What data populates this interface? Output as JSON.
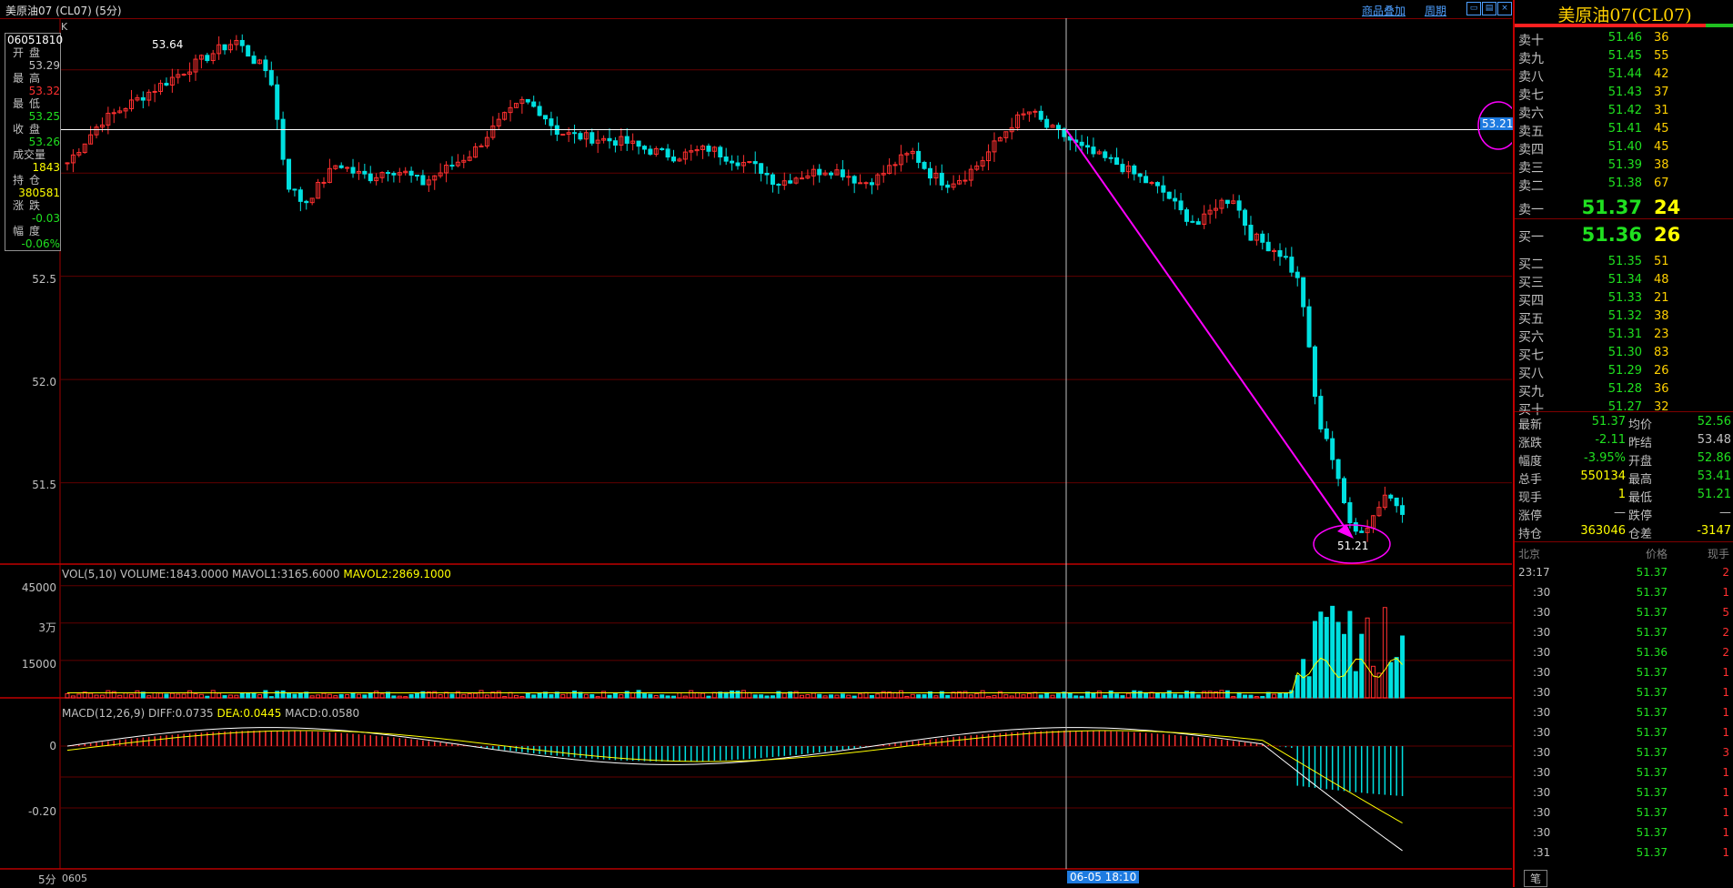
{
  "window": {
    "title": "美原油07 (CL07) (5分)",
    "links": [
      "商品叠加",
      "周期"
    ]
  },
  "ohlc_box": {
    "date": "06051810",
    "rows": [
      {
        "label": "开盘",
        "value": "53.29",
        "color": "#c0c0c0"
      },
      {
        "label": "最高",
        "value": "53.32",
        "color": "#ff3030"
      },
      {
        "label": "最低",
        "value": "53.25",
        "color": "#20e020"
      },
      {
        "label": "收盘",
        "value": "53.26",
        "color": "#20e020"
      },
      {
        "label": "成交量",
        "value": "1843",
        "color": "#ffff00"
      },
      {
        "label": "持仓",
        "value": "380581",
        "color": "#ffff00"
      },
      {
        "label": "涨跌",
        "value": "-0.03",
        "color": "#20e020"
      },
      {
        "label": "幅度",
        "value": "-0.06%",
        "color": "#20e020"
      }
    ]
  },
  "main_chart": {
    "k_label": "K",
    "y_ticks": [
      "52.5",
      "52.0",
      "51.5"
    ],
    "high_annotation": "53.64",
    "low_annotation": "51.21",
    "crosshair_price": "53.21",
    "crosshair_time": "06-05 18:10"
  },
  "volume_panel": {
    "title_parts": [
      "VOL(5,10) VOLUME:1843.0000",
      "MAVOL1:3165.6000",
      "MAVOL2:2869.1000"
    ],
    "colors": [
      "#ffffff",
      "#ffffff",
      "#ffff00"
    ],
    "y_ticks": [
      "45000",
      "3万",
      "15000"
    ]
  },
  "macd_panel": {
    "title_parts": [
      "MACD(12,26,9)",
      "DIFF:0.0735",
      "DEA:0.0445",
      "MACD:0.0580"
    ],
    "colors": [
      "#ffffff",
      "#ffffff",
      "#ffff00",
      "#ffffff"
    ],
    "y_ticks": [
      "0",
      "-0.20"
    ]
  },
  "bottom_bar": {
    "period": "5分",
    "date_start": "0605"
  },
  "chart_data": {
    "type": "candlestick",
    "title": "美原油07 (CL07) (5分)",
    "ylim": [
      51.15,
      53.75
    ],
    "candles_close_approx": [
      53.05,
      53.15,
      53.25,
      53.3,
      53.35,
      53.4,
      53.45,
      53.5,
      53.55,
      53.6,
      53.64,
      53.55,
      53.48,
      52.95,
      52.85,
      52.95,
      53.05,
      53.0,
      52.98,
      53.02,
      53.0,
      52.95,
      53.0,
      53.05,
      53.1,
      53.2,
      53.28,
      53.35,
      53.3,
      53.2,
      53.18,
      53.17,
      53.16,
      53.15,
      53.12,
      53.1,
      53.08,
      53.1,
      53.12,
      53.08,
      53.05,
      53.02,
      52.95,
      52.98,
      53.0,
      53.02,
      53.0,
      52.95,
      52.98,
      53.05,
      53.1,
      53.0,
      52.95,
      52.98,
      53.05,
      53.15,
      53.25,
      53.3,
      53.22,
      53.18,
      53.12,
      53.08,
      53.05,
      53.0,
      52.95,
      52.9,
      52.8,
      52.75,
      52.85,
      52.88,
      52.7,
      52.65,
      52.6,
      52.45,
      51.8,
      51.6,
      51.25,
      51.3,
      51.45,
      51.37
    ],
    "volume": {
      "y_ticks": [
        45000,
        30000,
        15000
      ],
      "last": 1843,
      "mavol1": 3165.6,
      "mavol2": 2869.1
    },
    "macd": {
      "params": [
        12,
        26,
        9
      ],
      "diff": 0.0735,
      "dea": 0.0445,
      "macd": 0.058,
      "y_ticks": [
        0,
        -0.2
      ]
    }
  },
  "order_book": {
    "title": "美原油07(CL07)",
    "asks": [
      {
        "label": "卖十",
        "price": "51.46",
        "vol": "36"
      },
      {
        "label": "卖九",
        "price": "51.45",
        "vol": "55"
      },
      {
        "label": "卖八",
        "price": "51.44",
        "vol": "42"
      },
      {
        "label": "卖七",
        "price": "51.43",
        "vol": "37"
      },
      {
        "label": "卖六",
        "price": "51.42",
        "vol": "31"
      },
      {
        "label": "卖五",
        "price": "51.41",
        "vol": "45"
      },
      {
        "label": "卖四",
        "price": "51.40",
        "vol": "45"
      },
      {
        "label": "卖三",
        "price": "51.39",
        "vol": "38"
      },
      {
        "label": "卖二",
        "price": "51.38",
        "vol": "67"
      },
      {
        "label": "卖一",
        "price": "51.37",
        "vol": "24"
      }
    ],
    "bids": [
      {
        "label": "买一",
        "price": "51.36",
        "vol": "26"
      },
      {
        "label": "买二",
        "price": "51.35",
        "vol": "51"
      },
      {
        "label": "买三",
        "price": "51.34",
        "vol": "48"
      },
      {
        "label": "买四",
        "price": "51.33",
        "vol": "21"
      },
      {
        "label": "买五",
        "price": "51.32",
        "vol": "38"
      },
      {
        "label": "买六",
        "price": "51.31",
        "vol": "23"
      },
      {
        "label": "买七",
        "price": "51.30",
        "vol": "83"
      },
      {
        "label": "买八",
        "price": "51.29",
        "vol": "26"
      },
      {
        "label": "买九",
        "price": "51.28",
        "vol": "36"
      },
      {
        "label": "买十",
        "price": "51.27",
        "vol": "32"
      }
    ]
  },
  "stats": [
    {
      "l1": "最新",
      "v1": "51.37",
      "c1": "#20e020",
      "l2": "均价",
      "v2": "52.56",
      "c2": "#20e020"
    },
    {
      "l1": "涨跌",
      "v1": "-2.11",
      "c1": "#20e020",
      "l2": "昨结",
      "v2": "53.48",
      "c2": "#c0c0c0"
    },
    {
      "l1": "幅度",
      "v1": "-3.95%",
      "c1": "#20e020",
      "l2": "开盘",
      "v2": "52.86",
      "c2": "#20e020"
    },
    {
      "l1": "总手",
      "v1": "550134",
      "c1": "#ffff00",
      "l2": "最高",
      "v2": "53.41",
      "c2": "#20e020"
    },
    {
      "l1": "现手",
      "v1": "1",
      "c1": "#ffff00",
      "l2": "最低",
      "v2": "51.21",
      "c2": "#20e020"
    },
    {
      "l1": "涨停",
      "v1": "—",
      "c1": "#c0c0c0",
      "l2": "跌停",
      "v2": "—",
      "c2": "#c0c0c0"
    },
    {
      "l1": "持仓",
      "v1": "363046",
      "c1": "#ffff00",
      "l2": "仓差",
      "v2": "-3147",
      "c2": "#ffff00"
    }
  ],
  "ticks": {
    "headers": [
      "北京",
      "价格",
      "现手"
    ],
    "rows": [
      {
        "time": "23:17",
        "price": "51.37",
        "vol": "2"
      },
      {
        "time": ":30",
        "price": "51.37",
        "vol": "1"
      },
      {
        "time": ":30",
        "price": "51.37",
        "vol": "5"
      },
      {
        "time": ":30",
        "price": "51.37",
        "vol": "2"
      },
      {
        "time": ":30",
        "price": "51.36",
        "vol": "2"
      },
      {
        "time": ":30",
        "price": "51.37",
        "vol": "1"
      },
      {
        "time": ":30",
        "price": "51.37",
        "vol": "1"
      },
      {
        "time": ":30",
        "price": "51.37",
        "vol": "1"
      },
      {
        "time": ":30",
        "price": "51.37",
        "vol": "1"
      },
      {
        "time": ":30",
        "price": "51.37",
        "vol": "3"
      },
      {
        "time": ":30",
        "price": "51.37",
        "vol": "1"
      },
      {
        "time": ":30",
        "price": "51.37",
        "vol": "1"
      },
      {
        "time": ":30",
        "price": "51.37",
        "vol": "1"
      },
      {
        "time": ":30",
        "price": "51.37",
        "vol": "1"
      },
      {
        "time": ":31",
        "price": "51.37",
        "vol": "1"
      }
    ],
    "footer_tab": "笔"
  }
}
